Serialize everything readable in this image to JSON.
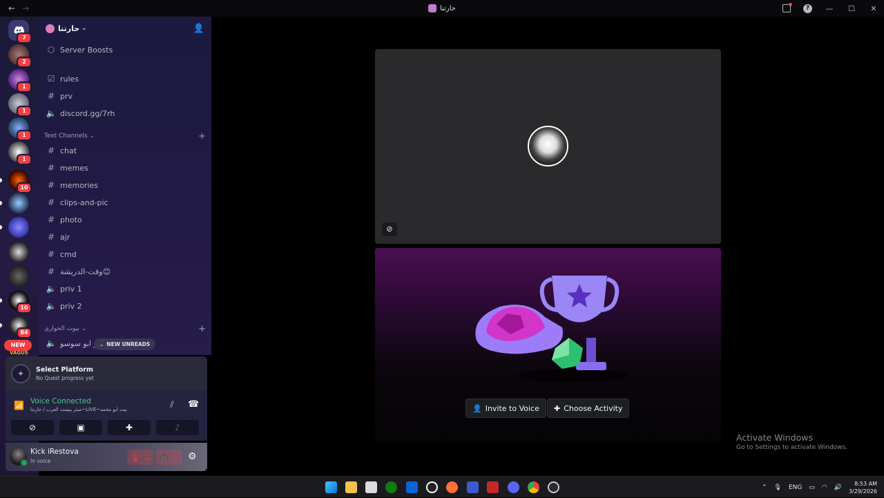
{
  "window": {
    "title": "حارتنا",
    "back_arrow": "←",
    "forward_arrow": "→"
  },
  "servers": {
    "badges": [
      "7",
      "2",
      "1",
      "1",
      "1",
      "1",
      "10",
      "10",
      "84"
    ],
    "new_label": "NEW",
    "vagus_label": "VAGUS"
  },
  "guild": {
    "name": "حارتنا",
    "boosts": "Server Boosts"
  },
  "channels": {
    "top": [
      {
        "name": "rules",
        "icon": "rules-icon"
      },
      {
        "name": "prv",
        "icon": "hash-icon"
      },
      {
        "name": "discord.gg/7rh",
        "icon": "speaker-icon"
      }
    ],
    "text_category": "Text Channels",
    "text": [
      {
        "name": "chat",
        "icon": "hash-icon"
      },
      {
        "name": "memes",
        "icon": "hash-icon"
      },
      {
        "name": "memories",
        "icon": "hash-icon"
      },
      {
        "name": "clips-and-pic",
        "icon": "hash-icon"
      },
      {
        "name": "photo",
        "icon": "hash-icon"
      },
      {
        "name": "ajr",
        "icon": "hash-icon"
      },
      {
        "name": "cmd",
        "icon": "hash-icon"
      },
      {
        "name": "وقت-الدريشة😊",
        "icon": "hash-icon"
      },
      {
        "name": "priv 1",
        "icon": "speaker-icon"
      },
      {
        "name": "priv 2",
        "icon": "speaker-icon"
      }
    ],
    "voice_category": "بيوت الحواري",
    "voice": [
      {
        "name": "سمر ابو سوسو",
        "icon": "speaker-icon"
      }
    ],
    "new_unreads": "NEW UNREADS"
  },
  "quest": {
    "title": "Select Platform",
    "subtitle": "No Quest progress yet"
  },
  "voice": {
    "status": "Voice Connected",
    "channel": "مبثر بيست العرب / حارتنا~LIVE~بيت ابو محمد"
  },
  "user": {
    "name": "Kick iRestova",
    "status": "In voice"
  },
  "stage": {
    "invite_label": "Invite to Voice",
    "activity_label": "Choose Activity"
  },
  "watermark": {
    "line1": "Activate Windows",
    "line2": "Go to Settings to activate Windows."
  },
  "taskbar": {
    "lang": "ENG",
    "time": "8:53 AM",
    "date": "3/29/2026"
  },
  "colors": {
    "voice_green": "#4fc58d",
    "badge_red": "#f23f43",
    "accent": "#5865f2"
  }
}
